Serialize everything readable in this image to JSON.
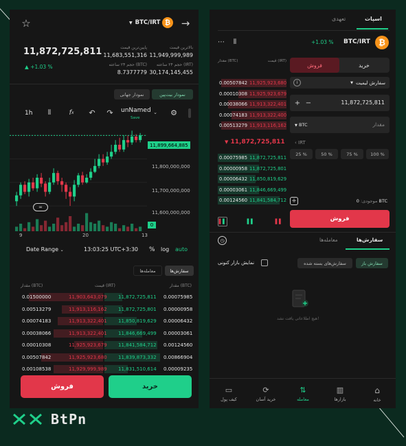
{
  "brand": {
    "logo": "BtPn"
  },
  "left": {
    "pair": "BTC/IRT",
    "price": "11,872,725,811",
    "change": "+1.03 %",
    "stats": [
      {
        "label": "بالاترین قیمت",
        "value": "11,949,999,989"
      },
      {
        "label": "پایین‌ترین قیمت",
        "value": "11,683,551,316"
      },
      {
        "label": "حجم ۲۴ ساعته (IRT)",
        "value": "30,174,145,455"
      },
      {
        "label": "حجم ۲۴ ساعته (BTC)",
        "value": "8.7377779"
      }
    ],
    "chart_tabs": [
      "نمودار بیت‌پین",
      "نمودار جهانی"
    ],
    "toolbar": {
      "interval": "1h",
      "layout_name": "unNamed",
      "layout_save": "Save"
    },
    "y_labels": [
      "11,899,664,885",
      "11,800,000,000",
      "11,700,000,000",
      "11,600,000,000",
      "0"
    ],
    "x_labels": [
      "9",
      "20",
      "13"
    ],
    "bottom": {
      "date_range": "Date Range",
      "time": "13:03:25 UTC+3:30",
      "pct": "%",
      "log": "log",
      "auto": "auto"
    },
    "tabs": [
      "سفارش‌ها",
      "معامله‌ها"
    ],
    "book_headers": [
      "مقدار (BTC)",
      "قیمت (IRT)",
      "مقدار (BTC)"
    ],
    "book": [
      [
        "0.01500000",
        "11,903,643,079",
        "11,872,725,811",
        "0.00075985"
      ],
      [
        "0.00513279",
        "11,913,116,162",
        "11,872,725,801",
        "0.00000958"
      ],
      [
        "0.00074183",
        "11,913,322,401",
        "11,850,819,629",
        "0.00006432"
      ],
      [
        "0.00038066",
        "11,913,322,401",
        "11,846,669,499",
        "0.00003061"
      ],
      [
        "0.00010308",
        "11,925,923,679",
        "11,841,584,712",
        "0.00124560"
      ],
      [
        "0.00507842",
        "11,925,923,680",
        "11,839,873,332",
        "0.00866904"
      ],
      [
        "0.00108538",
        "11,929,999,989",
        "11,831,510,614",
        "0.00009235"
      ]
    ],
    "sell_label": "فروش",
    "buy_label": "خرید"
  },
  "right": {
    "tabs": [
      "اسپات",
      "تعهدی"
    ],
    "pair": "BTC/IRT",
    "change": "+1.03 %",
    "book_headers": [
      "مقدار (BTC)",
      "قیمت (IRT)"
    ],
    "asks": [
      [
        "0.00507842",
        "11,925,923,680"
      ],
      [
        "0.00010308",
        "11,925,923,679"
      ],
      [
        "0.00038066",
        "11,913,322,401"
      ],
      [
        "0.00074183",
        "11,913,322,400"
      ],
      [
        "0.00513279",
        "11,913,116,162"
      ]
    ],
    "mid_price": "11,872,725,811",
    "bids": [
      [
        "0.00075985",
        "11,872,725,811"
      ],
      [
        "0.00000958",
        "11,872,725,801"
      ],
      [
        "0.00006432",
        "11,850,819,629"
      ],
      [
        "0.00003061",
        "11,846,669,499"
      ],
      [
        "0.00124560",
        "11,841,584,712"
      ]
    ],
    "buy_tab": "خرید",
    "sell_tab": "فروش",
    "order_type": "سفارش لیمیت",
    "price_value": "11,872,725,811",
    "amount_unit": "BTC",
    "amount_placeholder": "مقدار",
    "irt_label": "IRT",
    "pcts": [
      "25 %",
      "50 %",
      "75 %",
      "100 %"
    ],
    "balance_label": "موجودی:",
    "balance_value": "0 BTC",
    "sell_button": "فروش",
    "orders_tabs": [
      "سفارش‌ها",
      "معامله‌ها"
    ],
    "show_market": "نمایش بازار کنونی",
    "filters": [
      "سفارش باز",
      "سفارش‌های بسته شده"
    ],
    "empty_text": "هیچ اطلاعاتی یافت نشد!",
    "nav": [
      "خانه",
      "بازارها",
      "معامله",
      "خرید آسان",
      "کیف پول"
    ]
  },
  "chart_data": {
    "type": "candlestick",
    "candles": [
      [
        11620,
        11645,
        11600,
        11660
      ],
      [
        11645,
        11690,
        11630,
        11700
      ],
      [
        11690,
        11660,
        11650,
        11705
      ],
      [
        11660,
        11700,
        11640,
        11715
      ],
      [
        11700,
        11675,
        11665,
        11720
      ],
      [
        11675,
        11720,
        11660,
        11735
      ],
      [
        11720,
        11695,
        11680,
        11740
      ],
      [
        11695,
        11660,
        11640,
        11705
      ],
      [
        11660,
        11700,
        11650,
        11720
      ],
      [
        11700,
        11740,
        11690,
        11760
      ],
      [
        11740,
        11705,
        11690,
        11750
      ],
      [
        11705,
        11690,
        11660,
        11720
      ],
      [
        11690,
        11660,
        11630,
        11700
      ],
      [
        11660,
        11640,
        11600,
        11680
      ],
      [
        11640,
        11690,
        11620,
        11710
      ],
      [
        11690,
        11730,
        11680,
        11740
      ],
      [
        11730,
        11700,
        11690,
        11745
      ],
      [
        11700,
        11720,
        11695,
        11735
      ],
      [
        11720,
        11745,
        11710,
        11760
      ],
      [
        11745,
        11770,
        11740,
        11800
      ],
      [
        11770,
        11800,
        11760,
        11820
      ],
      [
        11800,
        11785,
        11770,
        11820
      ],
      [
        11785,
        11810,
        11775,
        11830
      ],
      [
        11810,
        11830,
        11800,
        11860
      ],
      [
        11830,
        11860,
        11820,
        11880
      ],
      [
        11860,
        11840,
        11830,
        11890
      ],
      [
        11840,
        11880,
        11830,
        11900
      ],
      [
        11880,
        11870,
        11850,
        11900
      ],
      [
        11870,
        11895,
        11860,
        11920
      ],
      [
        11895,
        11880,
        11870,
        11905
      ],
      [
        11880,
        11900,
        11870,
        11910
      ]
    ],
    "volumes": [
      3,
      5,
      2,
      6,
      3,
      8,
      4,
      7,
      3,
      5,
      9,
      4,
      6,
      10,
      3,
      5,
      4,
      12,
      6,
      5,
      7,
      4,
      3,
      6,
      5,
      2,
      4,
      3,
      5,
      2,
      3
    ],
    "last": 11899664885
  }
}
